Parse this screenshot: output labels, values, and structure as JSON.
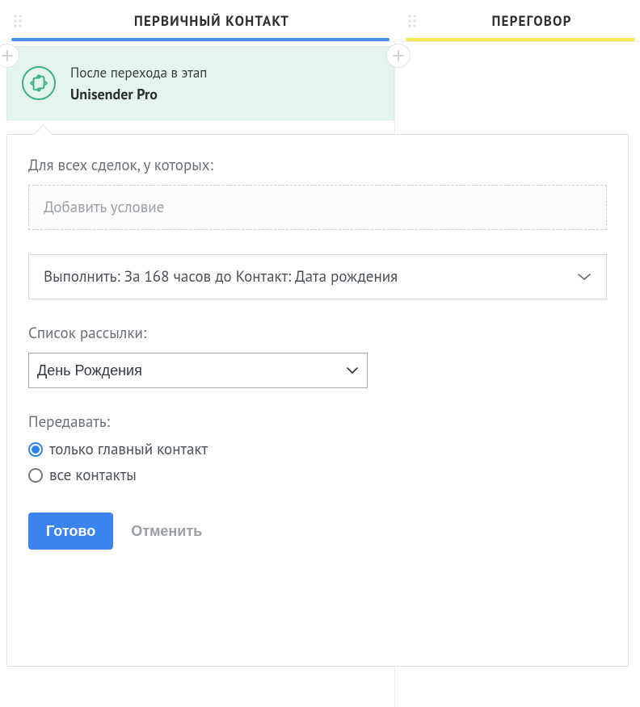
{
  "columns": [
    {
      "title": "ПЕРВИЧНЫЙ КОНТАКТ",
      "accent": "#4b8ff2"
    },
    {
      "title": "ПЕРЕГОВОР",
      "accent": "#f7e85a"
    }
  ],
  "trigger": {
    "line1": "После перехода в этап",
    "line2": "Unisender Pro"
  },
  "panel": {
    "filter_label": "Для всех сделок, у которых:",
    "add_condition_placeholder": "Добавить условие",
    "execute_select_value": "Выполнить: За 168 часов до Контакт: Дата рождения",
    "mailing_list_label": "Список рассылки:",
    "mailing_list_value": "День Рождения",
    "transfer_label": "Передавать:",
    "radio_main_contact": "только главный контакт",
    "radio_all_contacts": "все контакты",
    "radio_selected": "main",
    "submit": "Готово",
    "cancel": "Отменить"
  }
}
